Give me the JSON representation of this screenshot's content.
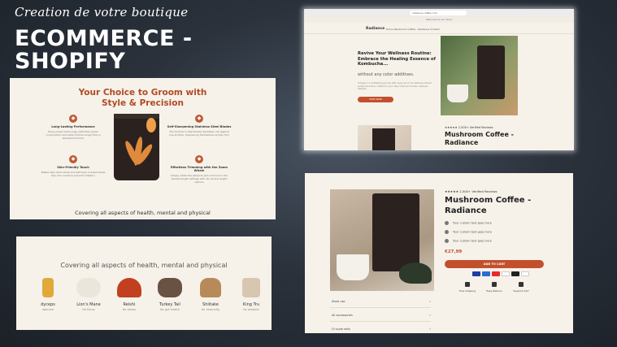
{
  "header": {
    "script_title": "Creation de votre boutique",
    "title_line1": "ECOMMERCE -",
    "title_line2": "SHOPIFY"
  },
  "groom_card": {
    "heading_line1": "Your Choice to Groom with",
    "heading_line2": "Style & Precision",
    "features": [
      {
        "title": "Long-Lasting Performance",
        "desc": "Enjoy power technology optimizes power consumption and lasts 4 times longer than a standard trimmer"
      },
      {
        "title": "Self-Sharpening Stainless Steel Blades",
        "desc": "The trimmer's steel blades delicately rub against one another, sharpening themselves as they trim"
      },
      {
        "title": "Skin-Friendly Touch",
        "desc": "Blades stay extra sharp but still have rounded blade tips and combs to prevent irritation"
      },
      {
        "title": "Effortless Trimming with the Zoom Wheel",
        "desc": "Simply rotate the wheel to pick and lock in the desired length settings with 20 various length options"
      }
    ],
    "footer": "Covering all aspects of health, mental and physical"
  },
  "ingredients_card": {
    "heading": "Covering all aspects of health, mental and physical",
    "items": [
      {
        "name": "dyceps",
        "sub": "stamina",
        "color": "#e0a93a"
      },
      {
        "name": "Lion's Mane",
        "sub": "for focus",
        "color": "#f1eee8"
      },
      {
        "name": "Reishi",
        "sub": "for stress",
        "color": "#c2401f"
      },
      {
        "name": "Turkey Tail",
        "sub": "for gut health",
        "color": "#6a5242"
      },
      {
        "name": "Shiitake",
        "sub": "for immunity",
        "color": "#b78a5a"
      },
      {
        "name": "King Tru",
        "sub": "for oxidativ",
        "color": "#d8c7b0"
      }
    ]
  },
  "browser_card": {
    "url": "radiance-coffee.com",
    "welcome": "Welcome to our store",
    "brand": "Radiance",
    "menu": "Home   Mushroom Coffee - Radiance   Contact",
    "hero_heading": "Revive Your Wellness Routine: Embrace the Healing Essence of Kombucha...",
    "hero_sub": "without any color additives.",
    "hero_paragraph": "Indulge in a revitalizing journey with every sip of our wellness-infused kombucha blend, crafted for your daily ritual and modern wellness lifestyle.",
    "shop_button": "SHOP NOW",
    "rating": "★★★★★  2,500+ Verified Reviews",
    "product_title_line1": "Mushroom Coffee -",
    "product_title_line2": "Radiance"
  },
  "product_card": {
    "rating": "★★★★★  2,500+ Verified Reviews",
    "title_line1": "Mushroom Coffee -",
    "title_line2": "Radiance",
    "features": [
      "Your custom text goes here",
      "Your custom text goes here",
      "Your custom text goes here"
    ],
    "price": "€27,99",
    "cart_button": "ADD TO CART",
    "payment_colors": [
      "#1a3fa8",
      "#2a6fd1",
      "#ea2a2a",
      "#ffffff",
      "#222222",
      "#ffffff"
    ],
    "perks": [
      "Free shipping",
      "Easy Returns",
      "Support 24/7"
    ],
    "accordion": [
      "Store use",
      "All accessories",
      "Ol scale sells"
    ]
  }
}
